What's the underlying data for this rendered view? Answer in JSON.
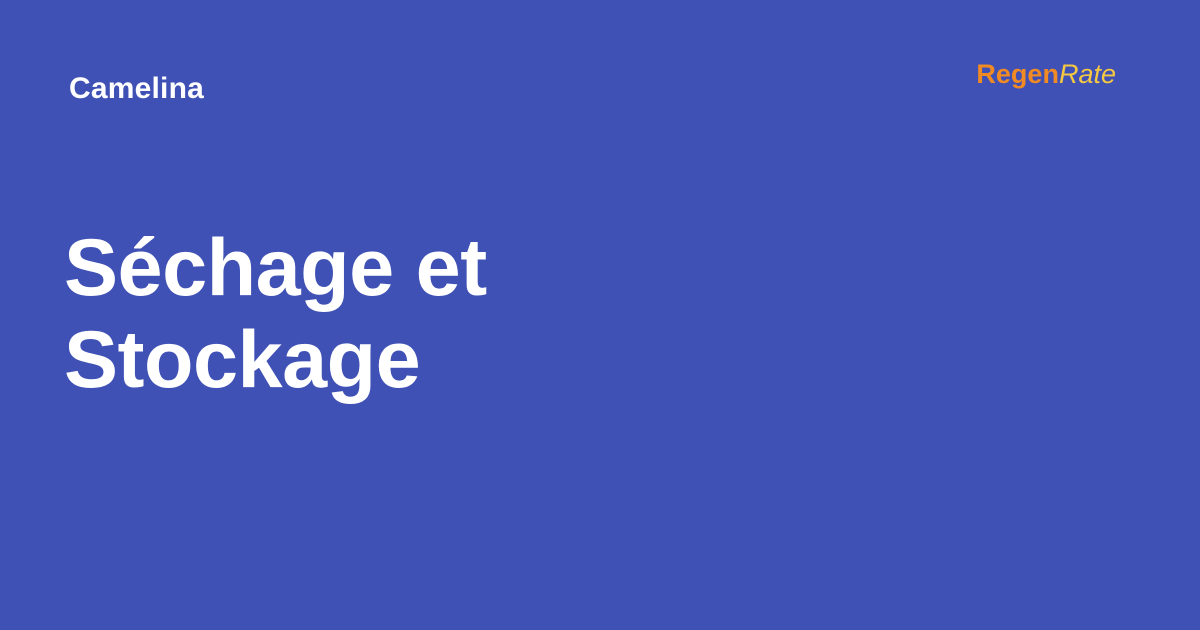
{
  "card": {
    "category": "Camelina",
    "title_line_1": "Séchage et",
    "title_line_2": "Stockage",
    "background_color": "#3f51b5"
  },
  "logo": {
    "regen": "Regen",
    "rate": "Rate",
    "regen_color": "#f08a24",
    "rate_color": "#f5c842"
  }
}
